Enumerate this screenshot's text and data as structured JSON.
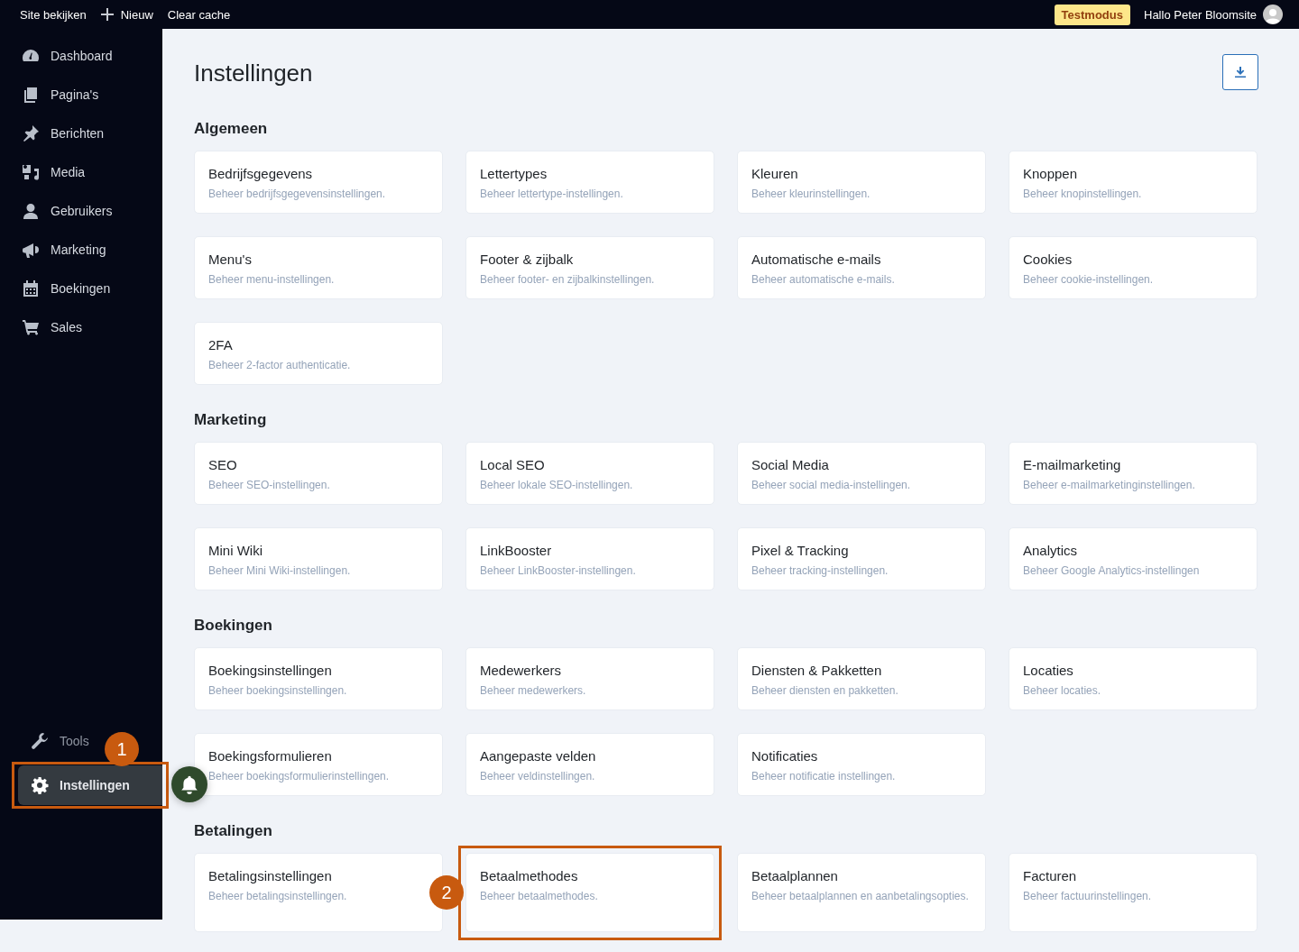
{
  "topbar": {
    "links": [
      {
        "label": "Site bekijken",
        "kind": "plain"
      },
      {
        "label": "Nieuw",
        "kind": "add"
      },
      {
        "label": "Clear cache",
        "kind": "plain"
      }
    ],
    "badge": "Testmodus",
    "greeting": "Hallo Peter Bloomsite"
  },
  "sidebar": {
    "items": [
      {
        "label": "Dashboard"
      },
      {
        "label": "Pagina's"
      },
      {
        "label": "Berichten"
      },
      {
        "label": "Media"
      },
      {
        "label": "Gebruikers"
      },
      {
        "label": "Marketing"
      },
      {
        "label": "Boekingen"
      },
      {
        "label": "Sales"
      }
    ],
    "bottom_items": [
      {
        "label": "Tools",
        "selected": false
      },
      {
        "label": "Instellingen",
        "selected": true,
        "annotation": "1"
      }
    ]
  },
  "page": {
    "title": "Instellingen",
    "sections": [
      {
        "title": "Algemeen",
        "cards": [
          {
            "title": "Bedrijfsgegevens",
            "description": "Beheer bedrijfsgegevensinstellingen."
          },
          {
            "title": "Lettertypes",
            "description": "Beheer lettertype-instellingen."
          },
          {
            "title": "Kleuren",
            "description": "Beheer kleurinstellingen."
          },
          {
            "title": "Knoppen",
            "description": "Beheer knopinstellingen."
          },
          {
            "title": "Menu's",
            "description": "Beheer menu-instellingen."
          },
          {
            "title": "Footer & zijbalk",
            "description": "Beheer footer- en zijbalkinstellingen."
          },
          {
            "title": "Automatische e-mails",
            "description": "Beheer automatische e-mails."
          },
          {
            "title": "Cookies",
            "description": "Beheer cookie-instellingen."
          },
          {
            "title": "2FA",
            "description": "Beheer 2-factor authenticatie."
          }
        ]
      },
      {
        "title": "Marketing",
        "cards": [
          {
            "title": "SEO",
            "description": "Beheer SEO-instellingen."
          },
          {
            "title": "Local SEO",
            "description": "Beheer lokale SEO-instellingen."
          },
          {
            "title": "Social Media",
            "description": "Beheer social media-instellingen."
          },
          {
            "title": "E-mailmarketing",
            "description": "Beheer e-mailmarketinginstellingen."
          },
          {
            "title": "Mini Wiki",
            "description": "Beheer Mini Wiki-instellingen."
          },
          {
            "title": "LinkBooster",
            "description": "Beheer LinkBooster-instellingen."
          },
          {
            "title": "Pixel & Tracking",
            "description": "Beheer tracking-instellingen."
          },
          {
            "title": "Analytics",
            "description": "Beheer Google Analytics-instellingen"
          }
        ]
      },
      {
        "title": "Boekingen",
        "cards": [
          {
            "title": "Boekingsinstellingen",
            "description": "Beheer boekingsinstellingen."
          },
          {
            "title": "Medewerkers",
            "description": "Beheer medewerkers."
          },
          {
            "title": "Diensten & Pakketten",
            "description": "Beheer diensten en pakketten."
          },
          {
            "title": "Locaties",
            "description": "Beheer locaties."
          },
          {
            "title": "Boekingsformulieren",
            "description": "Beheer boekingsformulierinstellingen."
          },
          {
            "title": "Aangepaste velden",
            "description": "Beheer veldinstellingen."
          },
          {
            "title": "Notificaties",
            "description": "Beheer notificatie instellingen."
          }
        ]
      },
      {
        "title": "Betalingen",
        "cards": [
          {
            "title": "Betalingsinstellingen",
            "description": "Beheer betalingsinstellingen."
          },
          {
            "title": "Betaalmethodes",
            "description": "Beheer betaalmethodes.",
            "annotation": "2"
          },
          {
            "title": "Betaalplannen",
            "description": "Beheer betaalplannen en aanbetalingsopties."
          },
          {
            "title": "Facturen",
            "description": "Beheer factuurinstellingen."
          }
        ]
      }
    ]
  }
}
